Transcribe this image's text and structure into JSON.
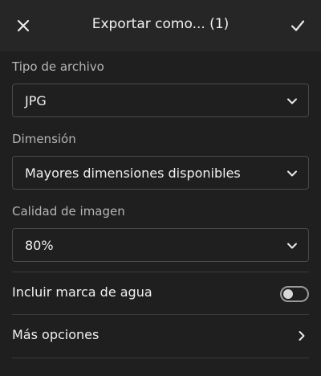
{
  "header": {
    "title": "Exportar como... (1)",
    "close_icon": "close-icon",
    "confirm_icon": "checkmark-icon"
  },
  "file_type": {
    "label": "Tipo de archivo",
    "value": "JPG"
  },
  "dimension": {
    "label": "Dimensión",
    "value": "Mayores dimensiones disponibles"
  },
  "quality": {
    "label": "Calidad de imagen",
    "value": "80%"
  },
  "watermark": {
    "label": "Incluir marca de agua",
    "enabled": false
  },
  "more_options": {
    "label": "Más opciones"
  },
  "colors": {
    "background": "#1f1f1f",
    "header": "#262626",
    "border": "#4a4a4a",
    "text": "#f0f0f0",
    "muted_text": "#b6b6b6"
  }
}
